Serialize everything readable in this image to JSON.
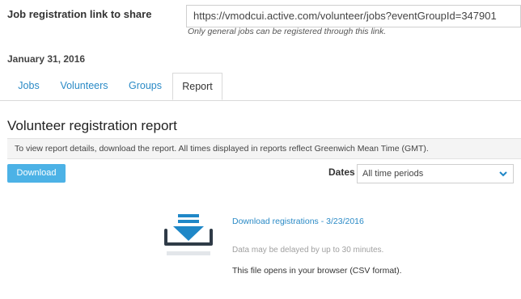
{
  "share": {
    "label": "Job registration link to share",
    "url": "https://vmodcui.active.com/volunteer/jobs?eventGroupId=347901",
    "note": "Only general jobs can be registered through this link."
  },
  "event_date": "January 31, 2016",
  "tabs": [
    {
      "label": "Jobs",
      "active": false
    },
    {
      "label": "Volunteers",
      "active": false
    },
    {
      "label": "Groups",
      "active": false
    },
    {
      "label": "Report",
      "active": true
    }
  ],
  "report": {
    "title": "Volunteer registration report",
    "info": "To view report details, download the report. All times displayed in reports reflect Greenwich Mean Time (GMT).",
    "download_label": "Download",
    "dates_label": "Dates",
    "dates_selected": "All time periods",
    "file_link": "Download registrations - 3/23/2016",
    "delay_note": "Data may be delayed by up to 30 minutes.",
    "browser_note": "This file opens in your browser (CSV format)."
  },
  "colors": {
    "accent": "#4cb2e6",
    "link": "#2a8ac6",
    "icon_dark": "#2f3b47",
    "icon_blue": "#1f87c7"
  },
  "icons": {
    "dates_chevron": "chevron-down-icon",
    "file_download": "download-tray-icon"
  }
}
